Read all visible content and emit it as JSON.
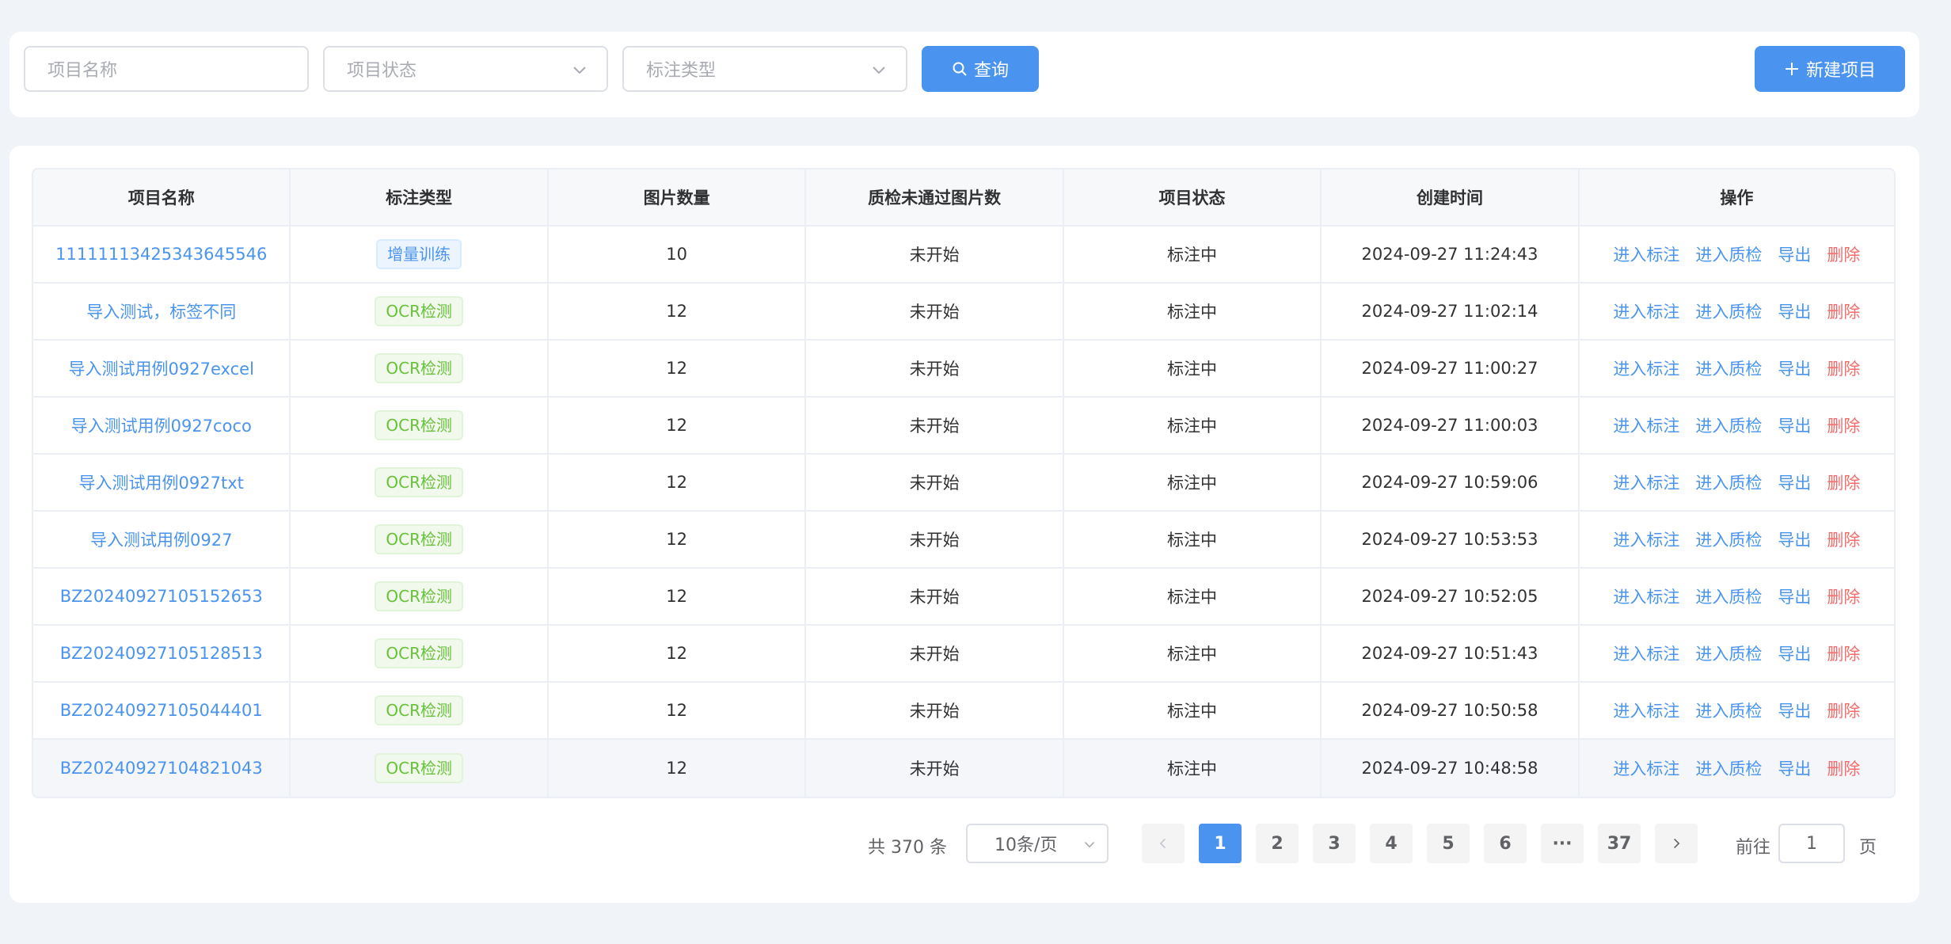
{
  "filters": {
    "name_placeholder": "项目名称",
    "status_placeholder": "项目状态",
    "type_placeholder": "标注类型",
    "search_label": "查询",
    "new_label": "新建项目"
  },
  "table": {
    "headers": [
      "项目名称",
      "标注类型",
      "图片数量",
      "质检未通过图片数",
      "项目状态",
      "创建时间",
      "操作"
    ],
    "rows": [
      {
        "name": "1111111342534364​5546",
        "type": "增量训练",
        "type_style": "blue",
        "count": "10",
        "qc": "未开始",
        "status": "标注中",
        "created": "2024-09-27 11:24:43"
      },
      {
        "name": "导入测试，标签不同",
        "type": "OCR检测",
        "type_style": "green",
        "count": "12",
        "qc": "未开始",
        "status": "标注中",
        "created": "2024-09-27 11:02:14"
      },
      {
        "name": "导入测试用例0927excel",
        "type": "OCR检测",
        "type_style": "green",
        "count": "12",
        "qc": "未开始",
        "status": "标注中",
        "created": "2024-09-27 11:00:27"
      },
      {
        "name": "导入测试用例0927coco",
        "type": "OCR检测",
        "type_style": "green",
        "count": "12",
        "qc": "未开始",
        "status": "标注中",
        "created": "2024-09-27 11:00:03"
      },
      {
        "name": "导入测试用例0927txt",
        "type": "OCR检测",
        "type_style": "green",
        "count": "12",
        "qc": "未开始",
        "status": "标注中",
        "created": "2024-09-27 10:59:06"
      },
      {
        "name": "导入测试用例0927",
        "type": "OCR检测",
        "type_style": "green",
        "count": "12",
        "qc": "未开始",
        "status": "标注中",
        "created": "2024-09-27 10:53:53"
      },
      {
        "name": "BZ20240927105152653",
        "type": "OCR检测",
        "type_style": "green",
        "count": "12",
        "qc": "未开始",
        "status": "标注中",
        "created": "2024-09-27 10:52:05"
      },
      {
        "name": "BZ20240927105128513",
        "type": "OCR检测",
        "type_style": "green",
        "count": "12",
        "qc": "未开始",
        "status": "标注中",
        "created": "2024-09-27 10:51:43"
      },
      {
        "name": "BZ20240927105044401",
        "type": "OCR检测",
        "type_style": "green",
        "count": "12",
        "qc": "未开始",
        "status": "标注中",
        "created": "2024-09-27 10:50:58"
      },
      {
        "name": "BZ20240927104821043",
        "type": "OCR检测",
        "type_style": "green",
        "count": "12",
        "qc": "未开始",
        "status": "标注中",
        "created": "2024-09-27 10:48:58"
      }
    ],
    "actions": {
      "annotate": "进入标注",
      "qc": "进入质检",
      "export": "导出",
      "delete": "删除"
    }
  },
  "pagination": {
    "total": "共 370 条",
    "page_size": "10条/页",
    "pages": [
      "1",
      "2",
      "3",
      "4",
      "5",
      "6",
      "···",
      "37"
    ],
    "current": "1",
    "goto_prefix": "前往",
    "goto_value": "1",
    "goto_suffix": "页"
  },
  "colors": {
    "primary": "#4a94ef",
    "success": "#67c23a",
    "danger": "#f56c6c",
    "background": "#f0f3f8"
  }
}
